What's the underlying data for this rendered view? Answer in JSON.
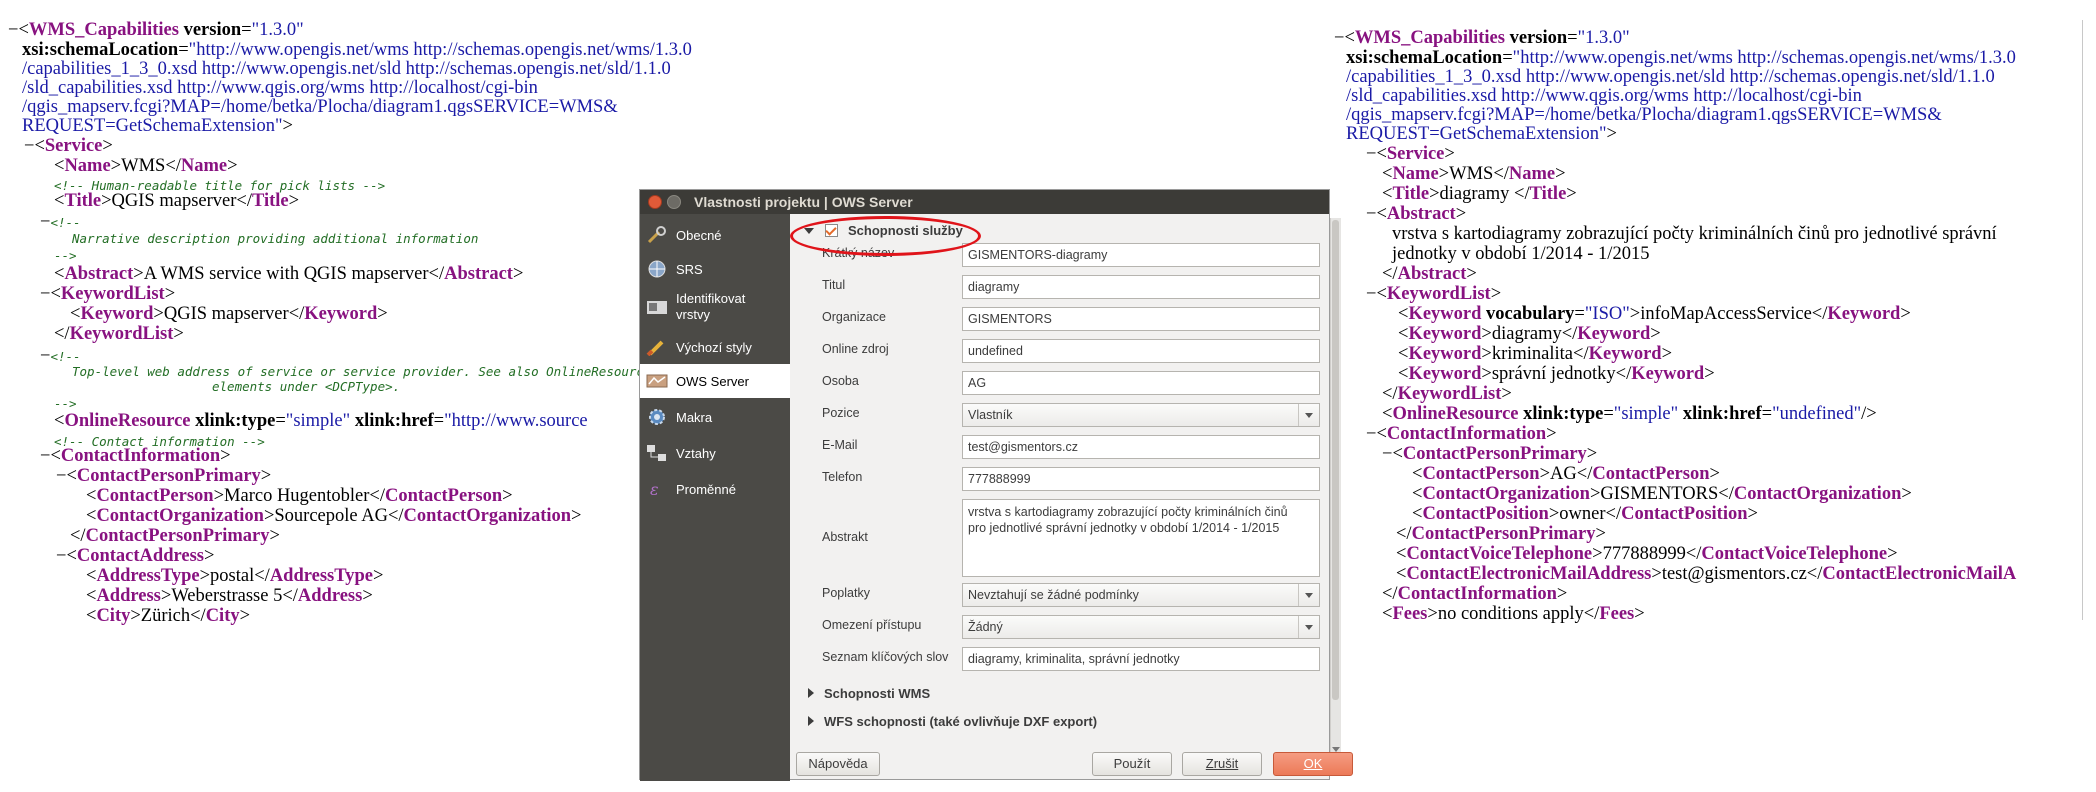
{
  "left_xml": {
    "root_tag": "WMS_Capabilities",
    "version_attr": "version",
    "version_val": "\"1.3.0\"",
    "schema_attr": "xsi:schemaLocation",
    "schema_val_1": "\"http://www.opengis.net/wms http://schemas.opengis.net/wms/1.3.0",
    "schema_val_2": "/capabilities_1_3_0.xsd http://www.opengis.net/sld http://schemas.opengis.net/sld/1.1.0",
    "schema_val_3": "/sld_capabilities.xsd http://www.qgis.org/wms http://localhost/cgi-bin",
    "schema_val_4": "/qgis_mapserv.fcgi?MAP=/home/betka/Plocha/diagram1.qgsSERVICE=WMS&",
    "schema_val_5": "REQUEST=GetSchemaExtension\"",
    "service_tag": "Service",
    "name_tag": "Name",
    "name_val": "WMS",
    "comment_title": "<!-- Human-readable title for pick lists -->",
    "title_tag": "Title",
    "title_val": "QGIS mapserver",
    "comment_abstract_1": "<!--",
    "comment_abstract_2": "Narrative description providing additional information",
    "comment_abstract_3": "-->",
    "abstract_tag": "Abstract",
    "abstract_val": "A WMS service with QGIS mapserver",
    "keywordlist_tag": "KeywordList",
    "keyword_tag": "Keyword",
    "keyword_val": "QGIS mapserver",
    "comment_online_1": "<!--",
    "comment_online_2": "Top-level web address of service or service provider.  See also OnlineResource",
    "comment_online_3": "elements under <DCPType>.",
    "comment_online_4": "-->",
    "online_tag": "OnlineResource",
    "xlink_type_attr": "xlink:type",
    "xlink_type_val": "\"simple\"",
    "xlink_href_attr": "xlink:href",
    "xlink_href_val": "\"http://www.source",
    "comment_contact": "<!-- Contact information -->",
    "contactinfo_tag": "ContactInformation",
    "cpp_tag": "ContactPersonPrimary",
    "cperson_tag": "ContactPerson",
    "cperson_val": "Marco Hugentobler",
    "corg_tag": "ContactOrganization",
    "corg_val": "Sourcepole AG",
    "caddress_tag": "ContactAddress",
    "addrtype_tag": "AddressType",
    "addrtype_val": "postal",
    "address_tag": "Address",
    "address_val": "Weberstrasse 5",
    "city_tag": "City",
    "city_val": "Zürich"
  },
  "right_xml": {
    "root_tag": "WMS_Capabilities",
    "version_attr": "version",
    "version_val": "\"1.3.0\"",
    "schema_attr": "xsi:schemaLocation",
    "schema_val_1": "\"http://www.opengis.net/wms http://schemas.opengis.net/wms/1.3.0",
    "schema_val_2": "/capabilities_1_3_0.xsd http://www.opengis.net/sld http://schemas.opengis.net/sld/1.1.0",
    "schema_val_3": "/sld_capabilities.xsd http://www.qgis.org/wms http://localhost/cgi-bin",
    "schema_val_4": "/qgis_mapserv.fcgi?MAP=/home/betka/Plocha/diagram1.qgsSERVICE=WMS&",
    "schema_val_5": "REQUEST=GetSchemaExtension\"",
    "service_tag": "Service",
    "name_tag": "Name",
    "name_val": "WMS",
    "title_tag": "Title",
    "title_val": "diagramy ",
    "abstract_tag": "Abstract",
    "abstract_val_1": "vrstva s kartodiagramy zobrazující počty kriminálních činů pro jednotlivé správní",
    "abstract_val_2": "jednotky v období 1/2014 - 1/2015",
    "keywordlist_tag": "KeywordList",
    "keyword_tag": "Keyword",
    "vocab_attr": "vocabulary",
    "vocab_val": "\"ISO\"",
    "kw1": "infoMapAccessService",
    "kw2": "diagramy",
    "kw3": "kriminalita",
    "kw4": "správní jednotky",
    "online_tag": "OnlineResource",
    "xlink_type_attr": "xlink:type",
    "xlink_type_val": "\"simple\"",
    "xlink_href_attr": "xlink:href",
    "xlink_href_val": "\"undefined\"",
    "contactinfo_tag": "ContactInformation",
    "cpp_tag": "ContactPersonPrimary",
    "cperson_tag": "ContactPerson",
    "cperson_val": "AG",
    "corg_tag": "ContactOrganization",
    "corg_val": "GISMENTORS",
    "cpos_tag": "ContactPosition",
    "cpos_val": "owner",
    "cvoice_tag": "ContactVoiceTelephone",
    "cvoice_val": "777888999",
    "cemail_tag": "ContactElectronicMailAddress",
    "cemail_tag_cut": "ContactElectronicMailA",
    "cemail_val": "test@gismentors.cz",
    "fees_tag": "Fees",
    "fees_val": "no conditions apply"
  },
  "dialog": {
    "title": "Vlastnosti projektu | OWS Server",
    "sidebar": [
      {
        "label": "Obecné",
        "icon": "wrench-icon"
      },
      {
        "label": "SRS",
        "icon": "globe-icon"
      },
      {
        "label": "Identifikovat\nvrstvy",
        "icon": "identify-icon"
      },
      {
        "label": "Výchozí styly",
        "icon": "brush-icon"
      },
      {
        "label": "OWS Server",
        "icon": "ows-icon"
      },
      {
        "label": "Makra",
        "icon": "gear-icon"
      },
      {
        "label": "Vztahy",
        "icon": "relations-icon"
      },
      {
        "label": "Proměnné",
        "icon": "variables-icon"
      }
    ],
    "section_service": "Schopnosti služby",
    "fields": {
      "short_name_label": "Krátký název",
      "short_name_value": "GISMENTORS-diagramy",
      "title_label": "Titul",
      "title_value": "diagramy",
      "org_label": "Organizace",
      "org_value": "GISMENTORS",
      "online_label": "Online zdroj",
      "online_value": "undefined",
      "person_label": "Osoba",
      "person_value": "AG",
      "position_label": "Pozice",
      "position_value": "Vlastník",
      "email_label": "E-Mail",
      "email_value": "test@gismentors.cz",
      "phone_label": "Telefon",
      "phone_value": "777888999",
      "abstract_label": "Abstrakt",
      "abstract_value_1": "vrstva s kartodiagramy zobrazující počty kriminálních činů",
      "abstract_value_2": "pro jednotlivé správní jednotky v období 1/2014 - 1/2015",
      "fees_label": "Poplatky",
      "fees_value": "Nevztahují se žádné podmínky",
      "access_label": "Omezení přístupu",
      "access_value": "Žádný",
      "keywords_label": "Seznam klíčových slov",
      "keywords_value": "diagramy, kriminalita, správní jednotky"
    },
    "section_wms": "Schopnosti WMS",
    "section_wfs": "WFS schopnosti (také ovlivňuje DXF export)",
    "buttons": {
      "help": "Nápověda",
      "apply": "Použít",
      "cancel": "Zrušit",
      "ok": "OK"
    },
    "colors": {
      "annotation_circle": "#e0141a",
      "ok_button": "#f0876a",
      "sidebar_bg": "#4b4a46",
      "title_bg": "#3c3b37",
      "close_button": "#e05a38"
    }
  }
}
